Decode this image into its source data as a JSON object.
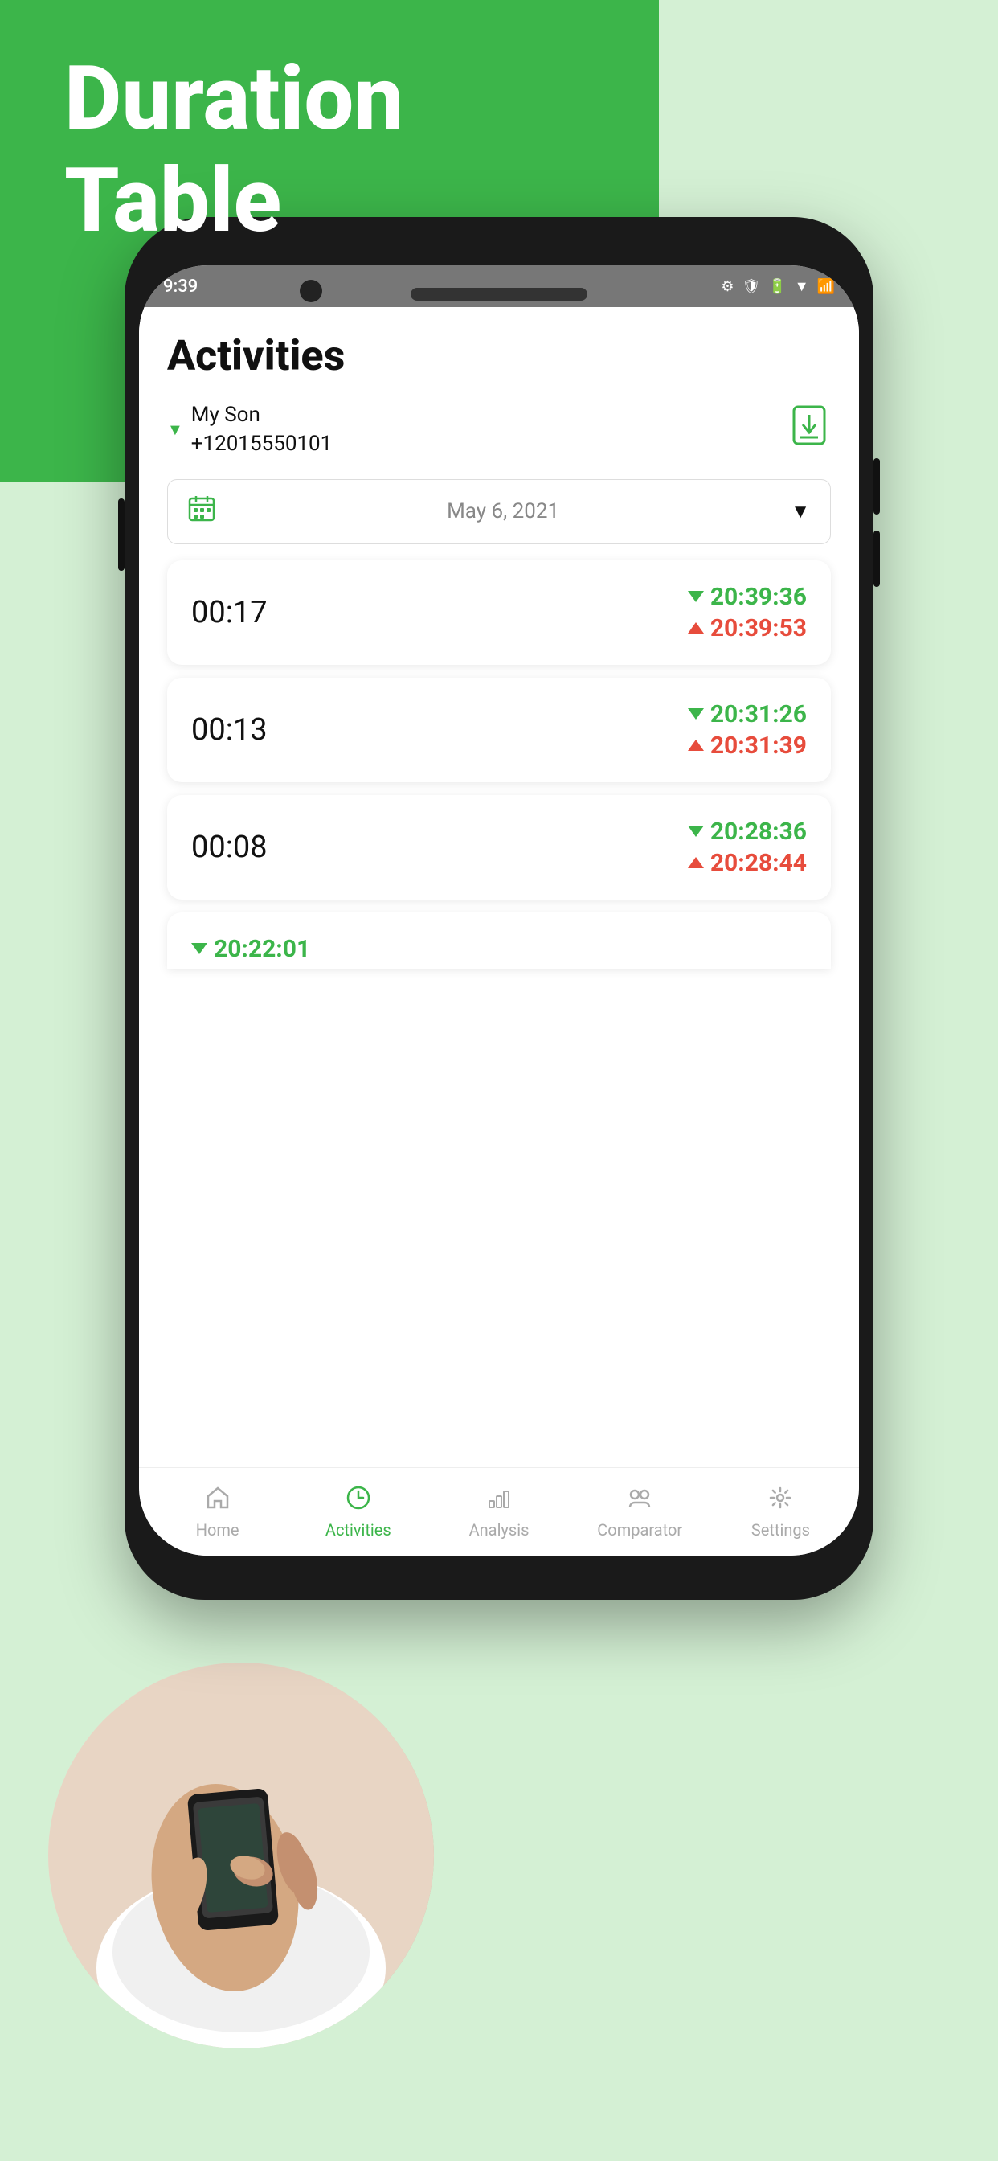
{
  "background": {
    "blob_color": "#3cb54a",
    "bg_color": "#d4f0d4"
  },
  "hero": {
    "title_line1": "Duration",
    "title_line2": "Table"
  },
  "status_bar": {
    "time": "9:39",
    "icons": [
      "gear",
      "shield",
      "battery"
    ]
  },
  "app": {
    "title": "Activities",
    "contact": {
      "name": "My Son",
      "phone": "+12015550101"
    },
    "date": "May 6, 2021",
    "activities": [
      {
        "duration": "00:17",
        "start_time": "20:39:36",
        "end_time": "20:39:53"
      },
      {
        "duration": "00:13",
        "start_time": "20:31:26",
        "end_time": "20:31:39"
      },
      {
        "duration": "00:08",
        "start_time": "20:28:36",
        "end_time": "20:28:44"
      },
      {
        "duration": "...",
        "start_time": "20:22:01",
        "end_time": null
      }
    ]
  },
  "tabs": [
    {
      "label": "Home",
      "icon": "🏠",
      "active": false
    },
    {
      "label": "Activities",
      "icon": "🕐",
      "active": true
    },
    {
      "label": "Analysis",
      "icon": "📊",
      "active": false
    },
    {
      "label": "Comparator",
      "icon": "👥",
      "active": false
    },
    {
      "label": "Settings",
      "icon": "⚙️",
      "active": false
    }
  ],
  "nav_buttons": {
    "back": "◀",
    "home": "●",
    "recent": "■"
  }
}
